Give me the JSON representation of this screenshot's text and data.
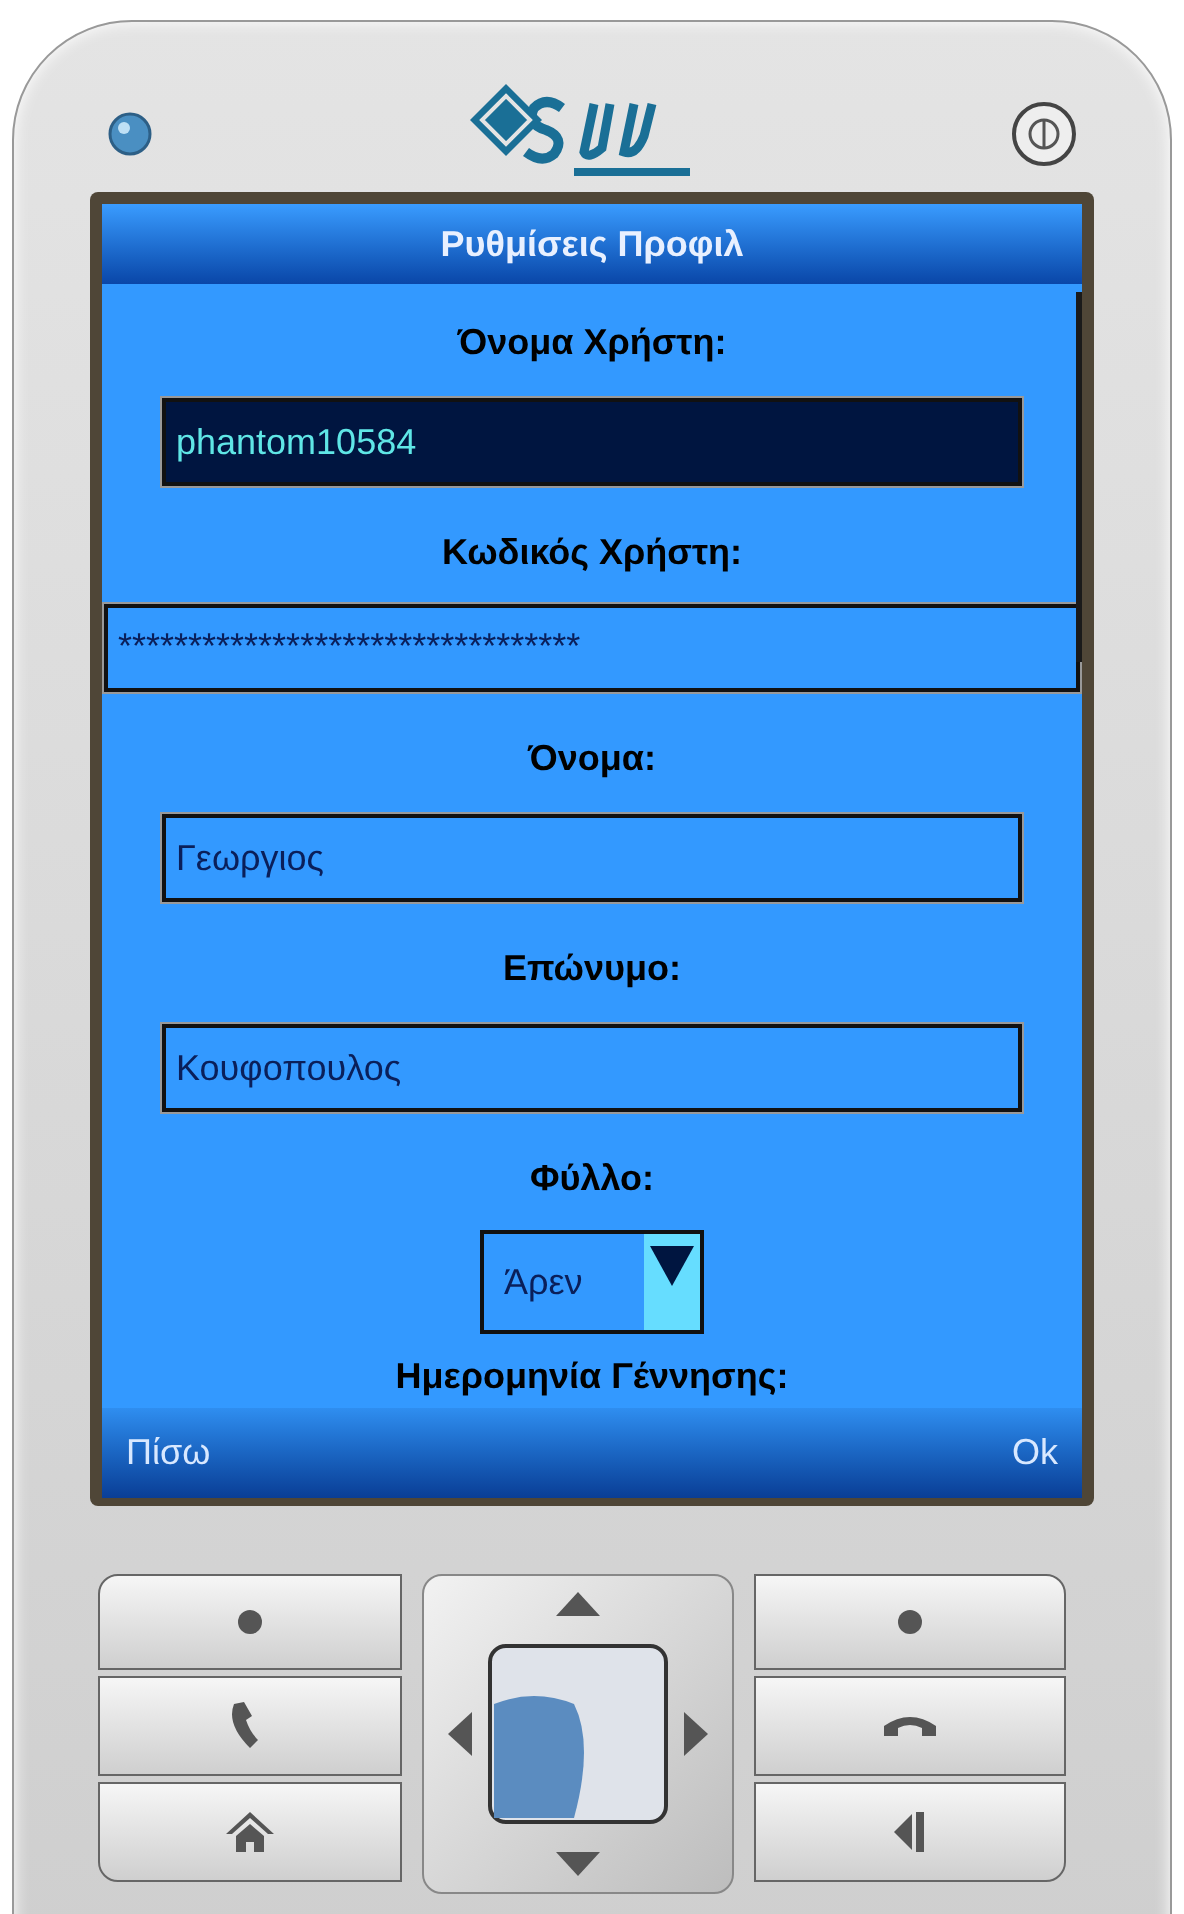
{
  "screen": {
    "title": "Ρυθμίσεις Προφιλ"
  },
  "fields": [
    {
      "label": "Όνομα Χρήστη:",
      "kind": "text",
      "value": "phantom10584",
      "selected": true
    },
    {
      "label": "Κωδικός Χρήστη:",
      "kind": "password",
      "value": "*********************************",
      "selected": false
    },
    {
      "label": "Όνομα:",
      "kind": "text",
      "value": "Γεωργιος",
      "selected": false
    },
    {
      "label": "Επώνυμο:",
      "kind": "text",
      "value": "Κουφοπουλος",
      "selected": false
    },
    {
      "label": "Φύλλο:",
      "kind": "choice",
      "value": "Άρεν",
      "selected": false
    },
    {
      "label": "Ημερομηνία Γέννησης:",
      "kind": "label"
    }
  ],
  "softkeys": {
    "left": "Πίσω",
    "right": "Ok"
  }
}
